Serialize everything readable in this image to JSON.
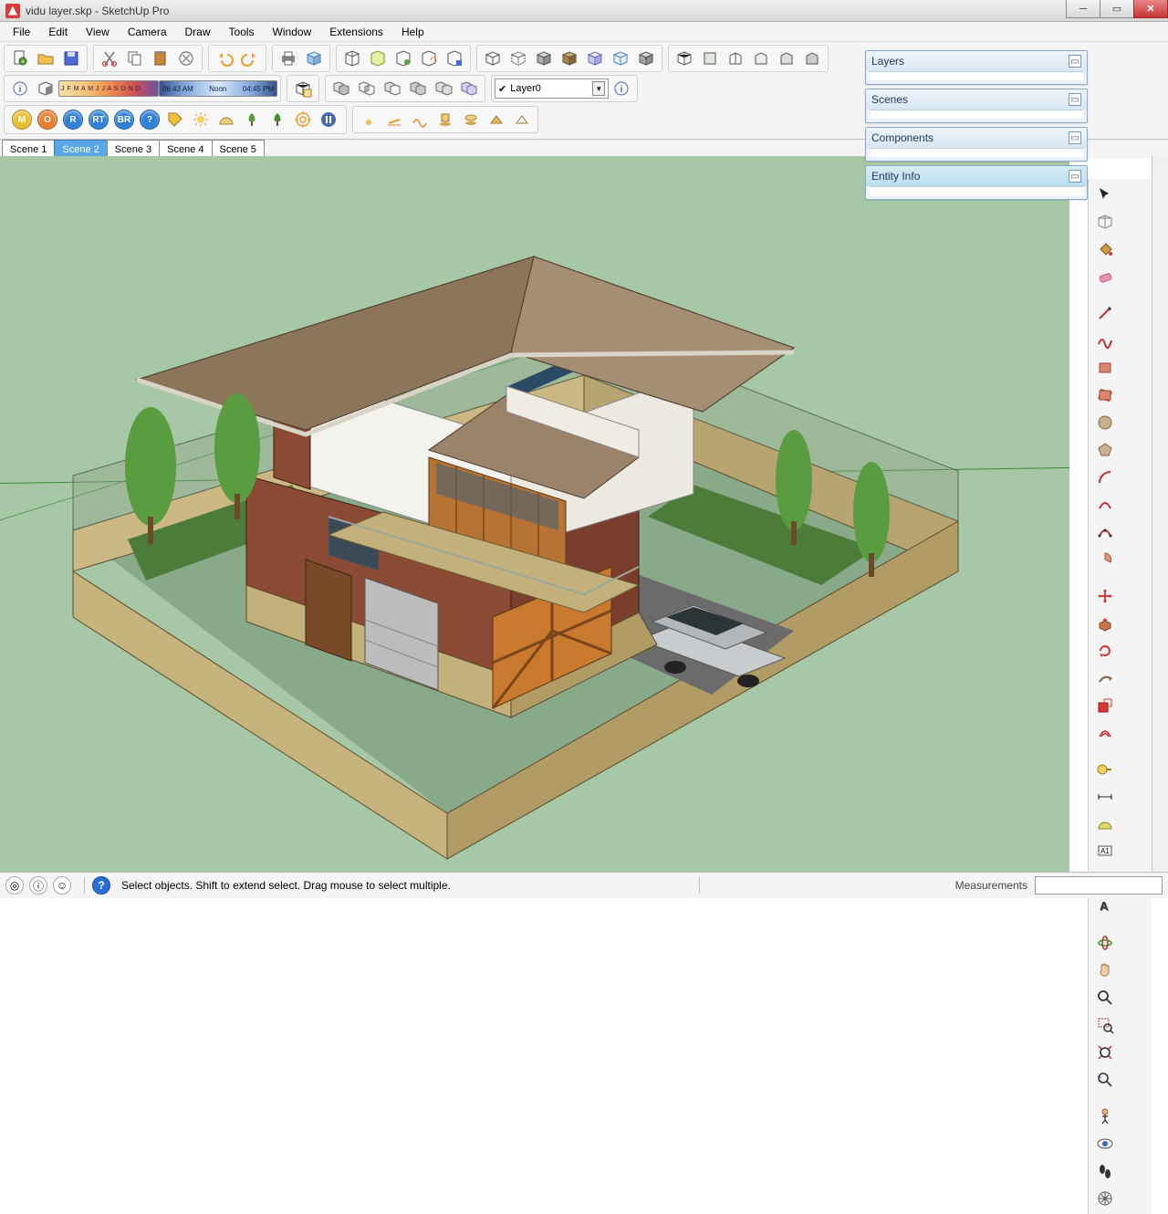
{
  "title": "vidu layer.skp - SketchUp Pro",
  "menus": [
    "File",
    "Edit",
    "View",
    "Camera",
    "Draw",
    "Tools",
    "Window",
    "Extensions",
    "Help"
  ],
  "scenes": [
    "Scene 1",
    "Scene 2",
    "Scene 3",
    "Scene 4",
    "Scene 5"
  ],
  "active_scene_index": 1,
  "shadow_months": "J F M A M J J A S O N D",
  "time_labels": {
    "dawn": "06:43 AM",
    "noon": "Noon",
    "dusk": "04:45 PM"
  },
  "layer_current": "Layer0",
  "panels": [
    "Layers",
    "Scenes",
    "Components",
    "Entity Info"
  ],
  "status_hint": "Select objects. Shift to extend select. Drag mouse to select multiple.",
  "measurements_label": "Measurements",
  "render_buttons": [
    {
      "t": "M",
      "c": "#e8c030"
    },
    {
      "t": "O",
      "c": "#e88030"
    },
    {
      "t": "R",
      "c": "#3080d8"
    },
    {
      "t": "RT",
      "c": "#3080d8"
    },
    {
      "t": "BR",
      "c": "#3080d8"
    },
    {
      "t": "?",
      "c": "#3080d8"
    }
  ]
}
